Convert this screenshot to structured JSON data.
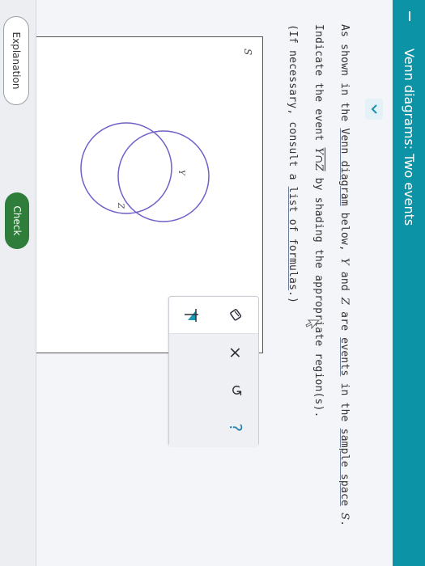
{
  "header": {
    "title": "Venn diagrams: Two events"
  },
  "question": {
    "line1": {
      "p1": "As shown in the ",
      "venn_link": "Venn diagram",
      "p2": " below, ",
      "var1": "Y",
      "p3": " and ",
      "var2": "Z",
      "p4": " are ",
      "events_link": "events",
      "p5": " in the ",
      "space_link": "sample space",
      "p6": " ",
      "var3": "S",
      "p7": "."
    },
    "line2": {
      "p1": "Indicate the event ",
      "expr": "Y∩Z",
      "p2": " by shading the appropriate region(s)."
    },
    "line3": {
      "p1": "(If necessary, consult a ",
      "formulas_link": "list of formulas",
      "p2": ".)"
    }
  },
  "venn": {
    "sample_label": "S",
    "set1_label": "Y",
    "set2_label": "Z"
  },
  "tools": {
    "eraser": "eraser-icon",
    "shade": "shade-region-icon",
    "clear": "×",
    "undo": "↺",
    "help": "?"
  },
  "footer": {
    "explanation_label": "Explanation",
    "check_label": "Check"
  },
  "colors": {
    "header": "#0d93a6",
    "check": "#2f7d3a",
    "circle_stroke": "#6f5fc9"
  }
}
